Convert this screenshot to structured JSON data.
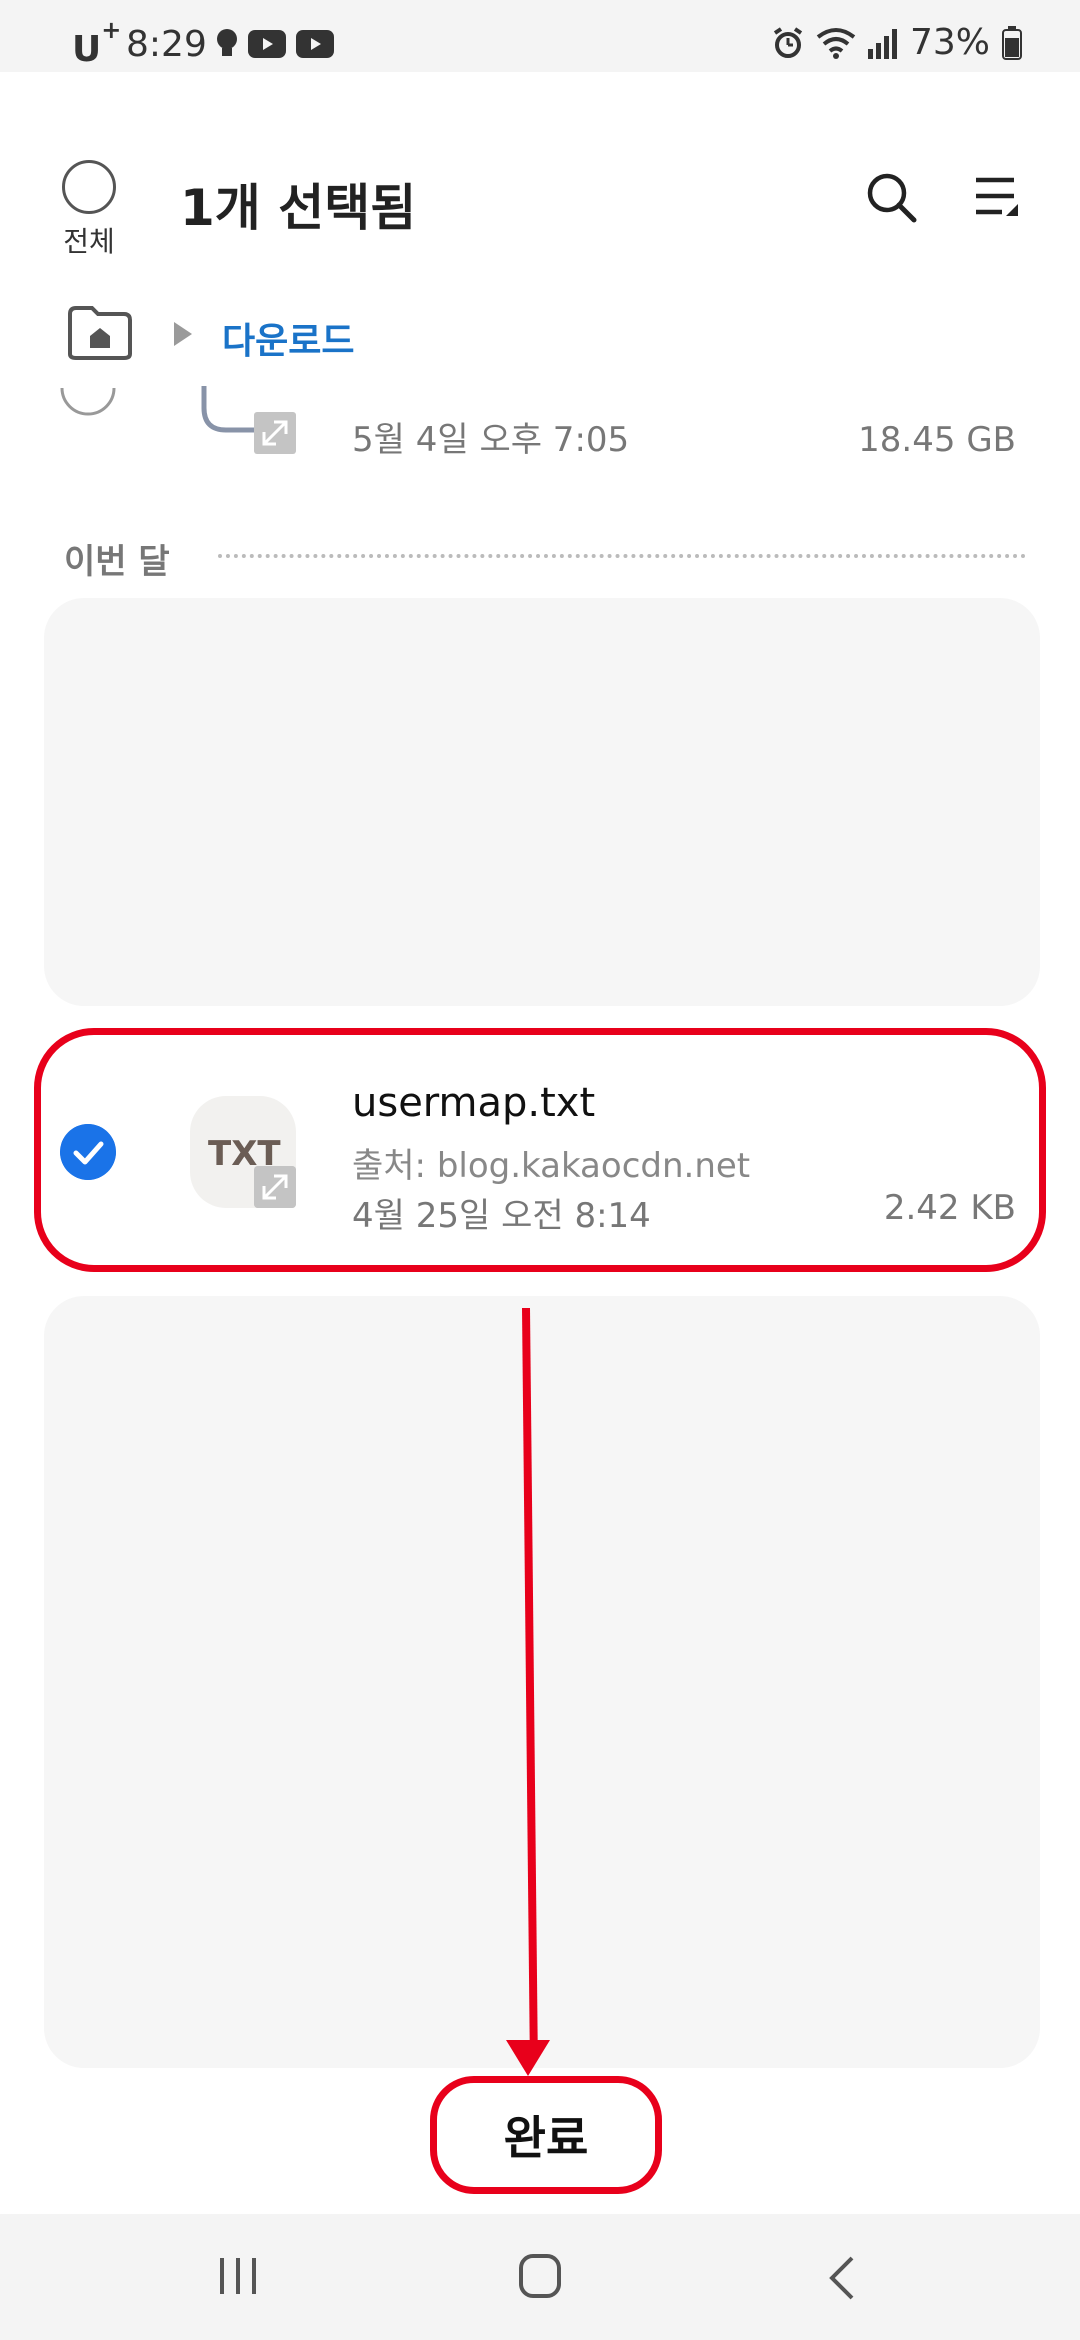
{
  "status_bar": {
    "carrier": "U",
    "carrier_sup": "+",
    "time": "8:29",
    "battery": "73%",
    "icons": [
      "bulb-icon",
      "youtube-icon",
      "youtube-icon",
      "alarm-icon",
      "wifi-icon",
      "signal-icon",
      "battery-icon"
    ]
  },
  "header": {
    "select_all_label": "전체",
    "title": "1개 선택됨",
    "search_icon": "search-icon",
    "sort_icon": "sort-icon"
  },
  "breadcrumb": {
    "home_icon": "home-folder-icon",
    "current": "다운로드"
  },
  "partial_row": {
    "date": "5월 4일 오후 7:05",
    "size": "18.45 GB"
  },
  "section": {
    "title": "이번 달"
  },
  "selected_file": {
    "thumb_label": "TXT",
    "name": "usermap.txt",
    "source": "출처: blog.kakaocdn.net",
    "date": "4월 25일 오전 8:14",
    "size": "2.42 KB",
    "checked": true
  },
  "done_button": {
    "label": "완료"
  },
  "nav_bar": {
    "icons": [
      "recent-apps-icon",
      "home-icon",
      "back-icon"
    ]
  },
  "colors": {
    "accent_blue": "#1a73e8",
    "annotation_red": "#e8001b",
    "breadcrumb_blue": "#1a73c8"
  }
}
